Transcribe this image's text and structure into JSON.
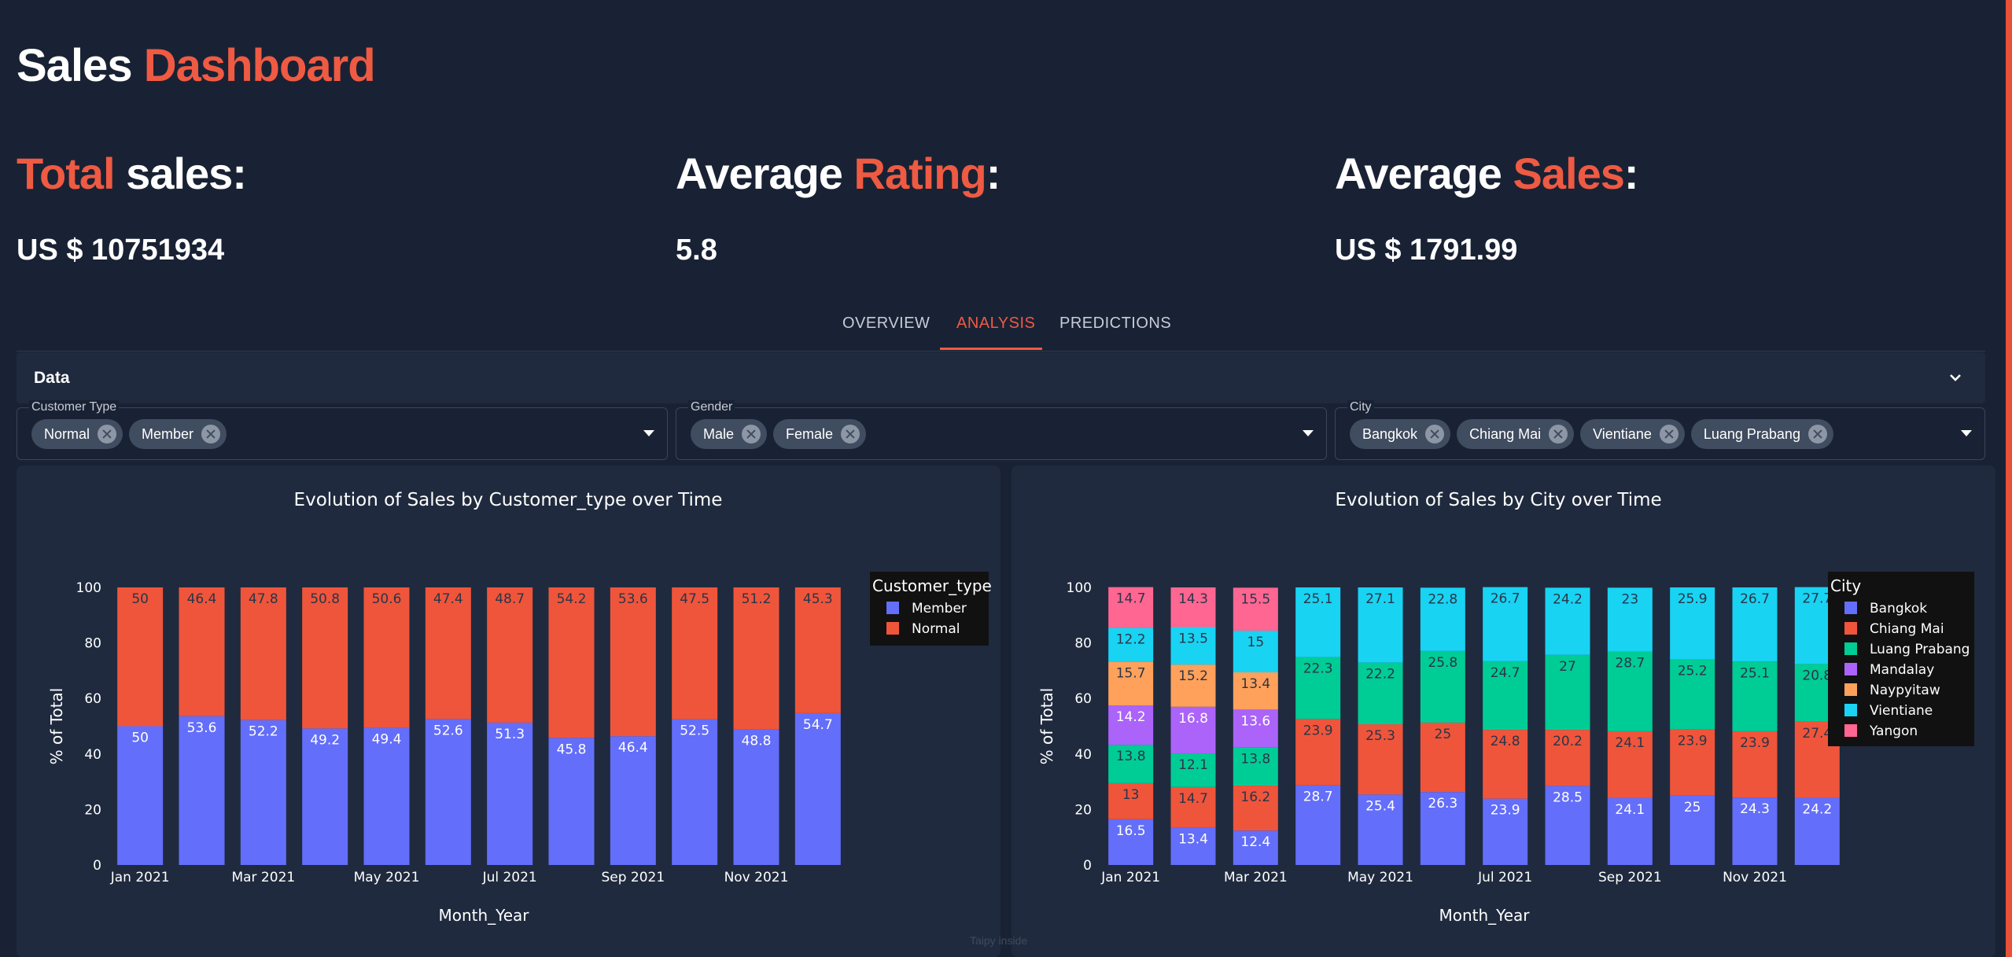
{
  "header": {
    "title_part1": "Sales",
    "title_part2": "Dashboard"
  },
  "kpis": [
    {
      "label_accent": "Total",
      "label_rest": "sales:",
      "value": "US $ 10751934"
    },
    {
      "label_pre": "Average",
      "label_accent": "Rating",
      "label_post": ":",
      "value": "5.8"
    },
    {
      "label_pre": "Average",
      "label_accent": "Sales",
      "label_post": ":",
      "value": "US $ 1791.99"
    }
  ],
  "tabs": [
    {
      "label": "OVERVIEW",
      "active": false
    },
    {
      "label": "ANALYSIS",
      "active": true
    },
    {
      "label": "PREDICTIONS",
      "active": false
    }
  ],
  "accordion": {
    "title": "Data",
    "icon": "chevron-down-icon"
  },
  "filters": {
    "customer_type": {
      "label": "Customer Type",
      "chips": [
        "Normal",
        "Member"
      ]
    },
    "gender": {
      "label": "Gender",
      "chips": [
        "Male",
        "Female"
      ]
    },
    "city": {
      "label": "City",
      "chips": [
        "Bangkok",
        "Chiang Mai",
        "Vientiane",
        "Luang Prabang"
      ]
    }
  },
  "colors": {
    "accent": "#ef5a43",
    "background": "#192234",
    "panel": "#1f2a3e"
  },
  "footer": {
    "text": "Taipy inside"
  },
  "chart_data": [
    {
      "type": "bar",
      "stacked": true,
      "title": "Evolution of Sales by Customer_type over Time",
      "xlabel": "Month_Year",
      "ylabel": "% of Total",
      "ylim": [
        0,
        100
      ],
      "yticks": [
        "0",
        "20",
        "40",
        "60",
        "80",
        "100"
      ],
      "xtick_labels": [
        "Jan 2021",
        "Mar 2021",
        "May 2021",
        "Jul 2021",
        "Sep 2021",
        "Nov 2021"
      ],
      "categories": [
        "Jan 2021",
        "Feb 2021",
        "Mar 2021",
        "Apr 2021",
        "May 2021",
        "Jun 2021",
        "Jul 2021",
        "Aug 2021",
        "Sep 2021",
        "Oct 2021",
        "Nov 2021",
        "Dec 2021"
      ],
      "legend_title": "Customer_type",
      "legend_position": "right",
      "series": [
        {
          "name": "Member",
          "color": "#636efa",
          "values": [
            50,
            53.6,
            52.2,
            49.2,
            49.4,
            52.6,
            51.3,
            45.8,
            46.4,
            52.5,
            48.8,
            54.7
          ],
          "text": [
            "50",
            "53.6",
            "52.2",
            "49.2",
            "49.4",
            "52.6",
            "51.3",
            "45.8",
            "46.4",
            "52.5",
            "48.8",
            "54.7"
          ]
        },
        {
          "name": "Normal",
          "color": "#ef553b",
          "values": [
            50,
            46.4,
            47.8,
            50.8,
            50.6,
            47.4,
            48.7,
            54.2,
            53.6,
            47.5,
            51.2,
            45.3
          ],
          "text": [
            "50",
            "46.4",
            "47.8",
            "50.8",
            "50.6",
            "47.4",
            "48.7",
            "54.2",
            "53.6",
            "47.5",
            "51.2",
            "45.3"
          ]
        }
      ]
    },
    {
      "type": "bar",
      "stacked": true,
      "title": "Evolution of Sales by City over Time",
      "xlabel": "Month_Year",
      "ylabel": "% of Total",
      "ylim": [
        0,
        100
      ],
      "yticks": [
        "0",
        "20",
        "40",
        "60",
        "80",
        "100"
      ],
      "xtick_labels": [
        "Jan 2021",
        "Mar 2021",
        "May 2021",
        "Jul 2021",
        "Sep 2021",
        "Nov 2021"
      ],
      "categories": [
        "Jan 2021",
        "Feb 2021",
        "Mar 2021",
        "Apr 2021",
        "May 2021",
        "Jun 2021",
        "Jul 2021",
        "Aug 2021",
        "Sep 2021",
        "Oct 2021",
        "Nov 2021",
        "Dec 2021"
      ],
      "legend_title": "City",
      "legend_position": "right",
      "series": [
        {
          "name": "Bangkok",
          "color": "#636efa",
          "values": [
            16.5,
            13.4,
            12.4,
            28.7,
            25.4,
            26.3,
            23.9,
            28.5,
            24.1,
            25,
            24.3,
            24.2
          ],
          "text": [
            "16.5",
            "13.4",
            "12.4",
            "28.7",
            "25.4",
            "26.3",
            "23.9",
            "28.5",
            "24.1",
            "25",
            "24.3",
            "24.2"
          ]
        },
        {
          "name": "Chiang Mai",
          "color": "#ef553b",
          "values": [
            13,
            14.7,
            16.2,
            23.9,
            25.3,
            25,
            24.8,
            20.2,
            24.1,
            23.9,
            23.9,
            27.4
          ],
          "text": [
            "13",
            "14.7",
            "16.2",
            "23.9",
            "25.3",
            "25",
            "24.8",
            "20.2",
            "24.1",
            "23.9",
            "23.9",
            "27.4"
          ]
        },
        {
          "name": "Luang Prabang",
          "color": "#00cc96",
          "values": [
            13.8,
            12.1,
            13.8,
            22.3,
            22.2,
            25.8,
            24.7,
            27,
            28.7,
            25.2,
            25.1,
            20.8
          ],
          "text": [
            "13.8",
            "12.1",
            "13.8",
            "22.3",
            "22.2",
            "25.8",
            "24.7",
            "27",
            "28.7",
            "25.2",
            "25.1",
            "20.8"
          ]
        },
        {
          "name": "Mandalay",
          "color": "#ab63fa",
          "values": [
            14.2,
            16.8,
            13.6,
            0,
            0,
            0,
            0,
            0,
            0,
            0,
            0,
            0
          ],
          "text": [
            "14.2",
            "16.8",
            "13.6",
            "",
            "",
            "",
            "",
            "",
            "",
            "",
            "",
            ""
          ]
        },
        {
          "name": "Naypyitaw",
          "color": "#ffa15a",
          "values": [
            15.7,
            15.2,
            13.4,
            0,
            0,
            0,
            0,
            0,
            0,
            0,
            0,
            0
          ],
          "text": [
            "15.7",
            "15.2",
            "13.4",
            "",
            "",
            "",
            "",
            "",
            "",
            "",
            "",
            ""
          ]
        },
        {
          "name": "Vientiane",
          "color": "#19d3f3",
          "values": [
            12.2,
            13.5,
            15,
            25.1,
            27.1,
            22.8,
            26.7,
            24.2,
            23,
            25.9,
            26.7,
            27.7
          ],
          "text": [
            "12.2",
            "13.5",
            "15",
            "25.1",
            "27.1",
            "22.8",
            "26.7",
            "24.2",
            "23",
            "25.9",
            "26.7",
            "27.7"
          ]
        },
        {
          "name": "Yangon",
          "color": "#ff6692",
          "values": [
            14.7,
            14.3,
            15.5,
            0,
            0,
            0,
            0,
            0,
            0,
            0,
            0,
            0
          ],
          "text": [
            "14.7",
            "14.3",
            "15.5",
            "",
            "",
            "",
            "",
            "",
            "",
            "",
            "",
            ""
          ]
        }
      ]
    }
  ]
}
